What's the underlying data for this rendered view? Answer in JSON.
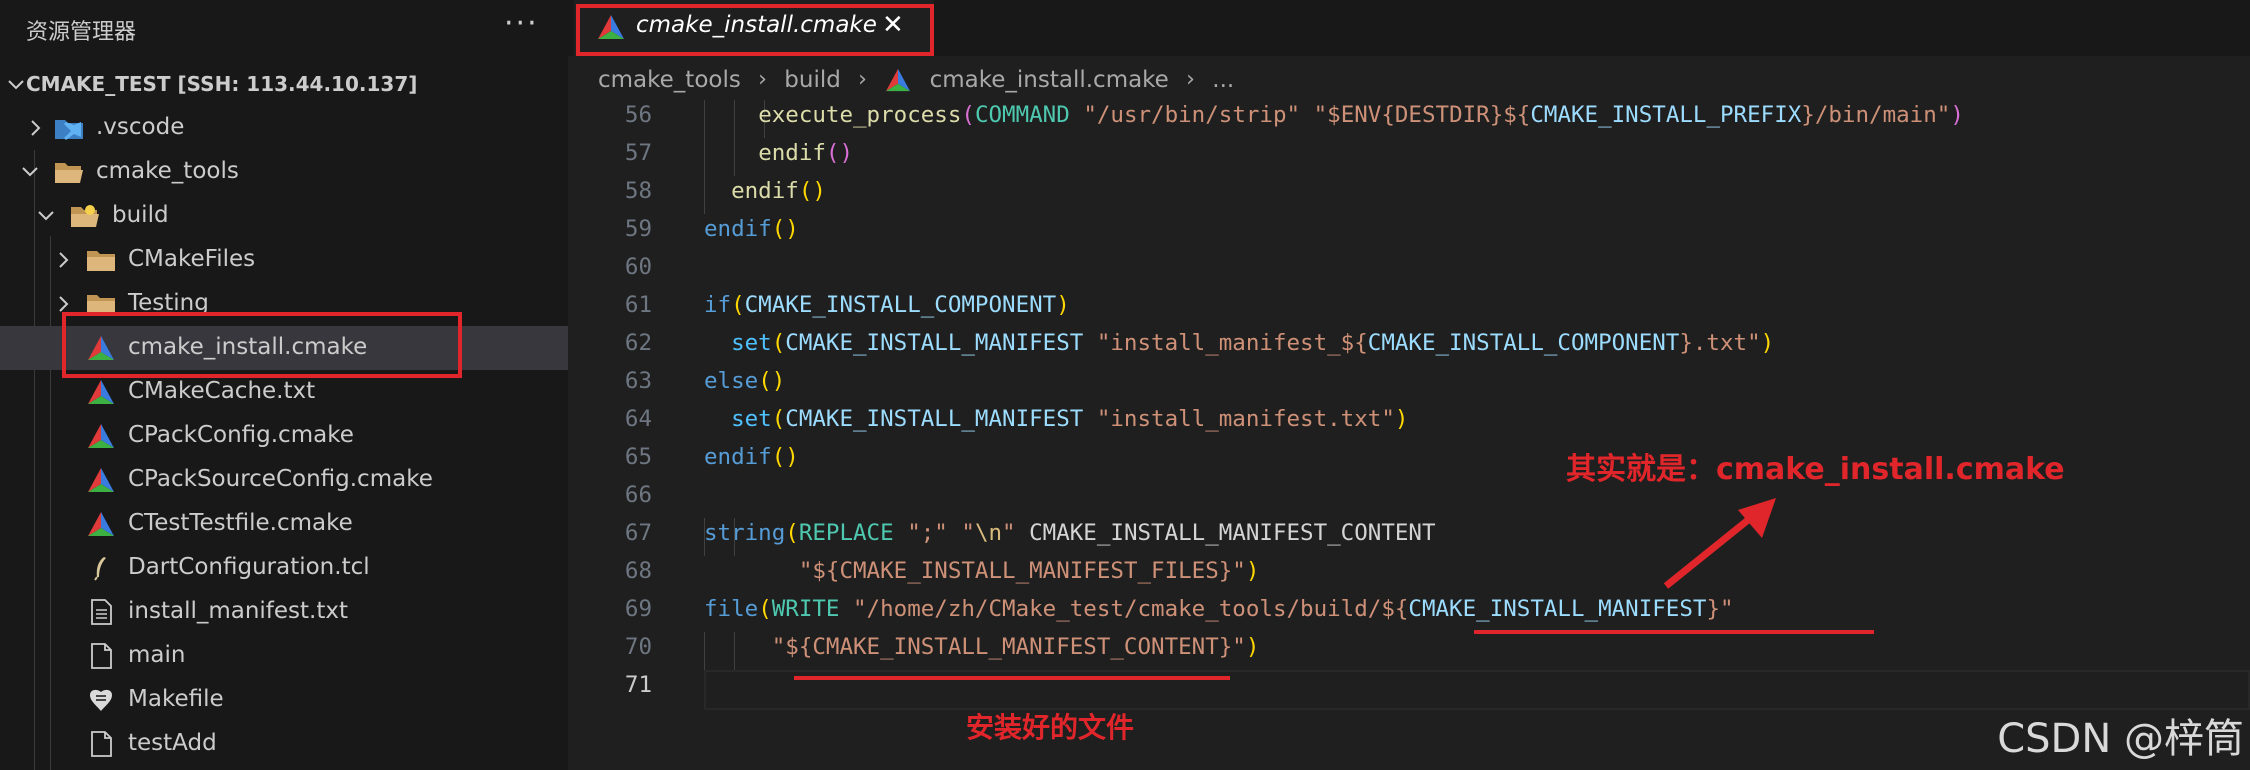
{
  "sidebar": {
    "title": "资源管理器",
    "more_label": "···",
    "workspace": "CMAKE_TEST [SSH: 113.44.10.137]",
    "items": [
      {
        "label": ".vscode",
        "icon": "vscode-folder-icon"
      },
      {
        "label": "cmake_tools",
        "icon": "folder-open-icon"
      },
      {
        "label": "build",
        "icon": "build-folder-open-icon"
      },
      {
        "label": "CMakeFiles",
        "icon": "folder-icon"
      },
      {
        "label": "Testing",
        "icon": "folder-icon"
      },
      {
        "label": "cmake_install.cmake",
        "icon": "cmake-icon"
      },
      {
        "label": "CMakeCache.txt",
        "icon": "cmake-icon"
      },
      {
        "label": "CPackConfig.cmake",
        "icon": "cmake-icon"
      },
      {
        "label": "CPackSourceConfig.cmake",
        "icon": "cmake-icon"
      },
      {
        "label": "CTestTestfile.cmake",
        "icon": "cmake-icon"
      },
      {
        "label": "DartConfiguration.tcl",
        "icon": "feather-icon"
      },
      {
        "label": "install_manifest.txt",
        "icon": "text-file-icon"
      },
      {
        "label": "main",
        "icon": "file-icon"
      },
      {
        "label": "Makefile",
        "icon": "makefile-icon"
      },
      {
        "label": "testAdd",
        "icon": "file-icon"
      }
    ]
  },
  "tab": {
    "label": "cmake_install.cmake",
    "close": "✕"
  },
  "breadcrumb": {
    "parts": [
      "cmake_tools",
      "build",
      "cmake_install.cmake",
      "..."
    ],
    "separator": "›"
  },
  "code": {
    "line_numbers": [
      "56",
      "57",
      "58",
      "59",
      "60",
      "61",
      "62",
      "63",
      "64",
      "65",
      "66",
      "67",
      "68",
      "69",
      "70",
      "71"
    ],
    "lines": [
      [
        [
          "    ",
          "t-plain"
        ],
        [
          "execute_process",
          "t-fn"
        ],
        [
          "(",
          "t-p2"
        ],
        [
          "COMMAND",
          "t-cmd"
        ],
        [
          " ",
          "t-plain"
        ],
        [
          "\"/usr/bin/strip\"",
          "t-str"
        ],
        [
          " ",
          "t-plain"
        ],
        [
          "\"$ENV{DESTDIR}${",
          "t-str"
        ],
        [
          "CMAKE_INSTALL_PREFIX",
          "t-var"
        ],
        [
          "}/bin/main\"",
          "t-str"
        ],
        [
          ")",
          "t-p2"
        ]
      ],
      [
        [
          "    ",
          "t-plain"
        ],
        [
          "endif",
          "t-fn"
        ],
        [
          "()",
          "t-p2"
        ]
      ],
      [
        [
          "  ",
          "t-plain"
        ],
        [
          "endif",
          "t-fn"
        ],
        [
          "()",
          "t-p1"
        ]
      ],
      [
        [
          "endif",
          "t-kw"
        ],
        [
          "()",
          "t-p1"
        ]
      ],
      [],
      [
        [
          "if",
          "t-kw"
        ],
        [
          "(",
          "t-p1"
        ],
        [
          "CMAKE_INSTALL_COMPONENT",
          "t-var"
        ],
        [
          ")",
          "t-p1"
        ]
      ],
      [
        [
          "  ",
          "t-plain"
        ],
        [
          "set",
          "t-fnb"
        ],
        [
          "(",
          "t-p1"
        ],
        [
          "CMAKE_INSTALL_MANIFEST",
          "t-var"
        ],
        [
          " ",
          "t-plain"
        ],
        [
          "\"install_manifest_${",
          "t-str"
        ],
        [
          "CMAKE_INSTALL_COMPONENT",
          "t-var"
        ],
        [
          "}.txt\"",
          "t-str"
        ],
        [
          ")",
          "t-p1"
        ]
      ],
      [
        [
          "else",
          "t-kw"
        ],
        [
          "()",
          "t-p1"
        ]
      ],
      [
        [
          "  ",
          "t-plain"
        ],
        [
          "set",
          "t-fnb"
        ],
        [
          "(",
          "t-p1"
        ],
        [
          "CMAKE_INSTALL_MANIFEST",
          "t-var"
        ],
        [
          " ",
          "t-plain"
        ],
        [
          "\"install_manifest.txt\"",
          "t-str"
        ],
        [
          ")",
          "t-p1"
        ]
      ],
      [
        [
          "endif",
          "t-kw"
        ],
        [
          "()",
          "t-p1"
        ]
      ],
      [],
      [
        [
          "string",
          "t-kw"
        ],
        [
          "(",
          "t-p1"
        ],
        [
          "REPLACE",
          "t-cmd"
        ],
        [
          " ",
          "t-plain"
        ],
        [
          "\";\"",
          "t-str"
        ],
        [
          " ",
          "t-plain"
        ],
        [
          "\"",
          "t-str"
        ],
        [
          "\\n",
          "t-esc"
        ],
        [
          "\"",
          "t-str"
        ],
        [
          " CMAKE_INSTALL_MANIFEST_CONTENT",
          "t-plain"
        ]
      ],
      [
        [
          "       ",
          "t-plain"
        ],
        [
          "\"${",
          "t-str"
        ],
        [
          "CMAKE_INSTALL_MANIFEST_FILES",
          "t-str"
        ],
        [
          "}\"",
          "t-str"
        ],
        [
          ")",
          "t-p1"
        ]
      ],
      [
        [
          "file",
          "t-kw"
        ],
        [
          "(",
          "t-p1"
        ],
        [
          "WRITE",
          "t-cmd"
        ],
        [
          " ",
          "t-plain"
        ],
        [
          "\"/home/zh/CMake_test/cmake_tools/build/${",
          "t-str"
        ],
        [
          "CMAKE_INSTALL_MANIFEST",
          "t-var"
        ],
        [
          "}\"",
          "t-str"
        ]
      ],
      [
        [
          "     ",
          "t-plain"
        ],
        [
          "\"${CMAKE_INSTALL_MANIFEST_CONTENT}\"",
          "t-str"
        ],
        [
          ")",
          "t-p1"
        ]
      ],
      []
    ]
  },
  "annotations": {
    "note_actual": "其实就是：cmake_install.cmake",
    "note_installed": "安装好的文件",
    "color": "#e0262a"
  },
  "watermark": "CSDN @梓筒"
}
